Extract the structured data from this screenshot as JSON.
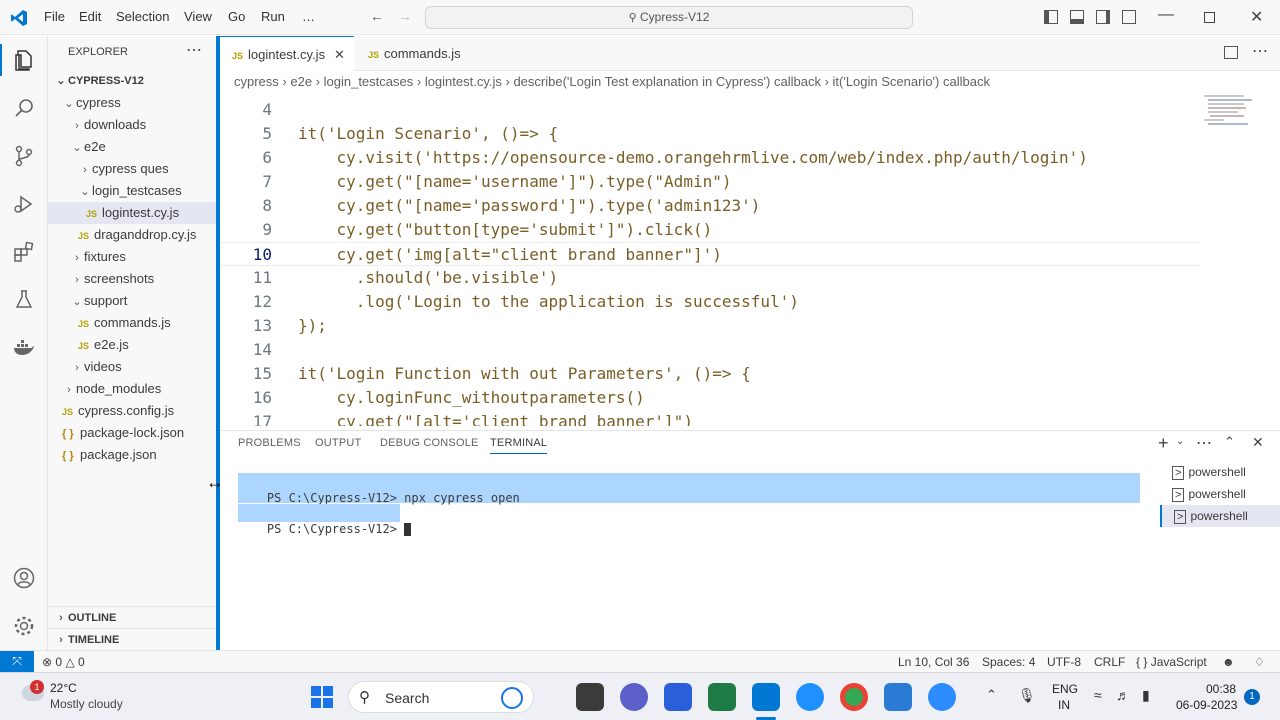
{
  "titlebar": {
    "menu": [
      "File",
      "Edit",
      "Selection",
      "View",
      "Go",
      "Run",
      "…"
    ],
    "command_center": "Cypress-V12"
  },
  "sidebar": {
    "header": "EXPLORER",
    "project": "CYPRESS-V12",
    "tree": [
      {
        "label": "cypress",
        "kind": "folder-open",
        "indent": 1
      },
      {
        "label": "downloads",
        "kind": "folder",
        "indent": 2
      },
      {
        "label": "e2e",
        "kind": "folder-open",
        "indent": 2
      },
      {
        "label": "cypress ques",
        "kind": "folder",
        "indent": 3
      },
      {
        "label": "login_testcases",
        "kind": "folder-open",
        "indent": 3
      },
      {
        "label": "logintest.cy.js",
        "kind": "js",
        "indent": 4,
        "selected": true
      },
      {
        "label": "draganddrop.cy.js",
        "kind": "js",
        "indent": 3
      },
      {
        "label": "fixtures",
        "kind": "folder",
        "indent": 2
      },
      {
        "label": "screenshots",
        "kind": "folder",
        "indent": 2
      },
      {
        "label": "support",
        "kind": "folder-open",
        "indent": 2
      },
      {
        "label": "commands.js",
        "kind": "js",
        "indent": 3
      },
      {
        "label": "e2e.js",
        "kind": "js",
        "indent": 3
      },
      {
        "label": "videos",
        "kind": "folder",
        "indent": 2
      },
      {
        "label": "node_modules",
        "kind": "folder",
        "indent": 1
      },
      {
        "label": "cypress.config.js",
        "kind": "js",
        "indent": 1
      },
      {
        "label": "package-lock.json",
        "kind": "json",
        "indent": 1
      },
      {
        "label": "package.json",
        "kind": "json",
        "indent": 1
      }
    ],
    "outline": "OUTLINE",
    "timeline": "TIMELINE"
  },
  "editor": {
    "tabs": [
      {
        "label": "logintest.cy.js",
        "active": true
      },
      {
        "label": "commands.js",
        "active": false
      }
    ],
    "breadcrumb": [
      "cypress",
      "e2e",
      "login_testcases",
      "logintest.cy.js",
      "describe('Login Test explanation in Cypress') callback",
      "it('Login Scenario') callback"
    ],
    "lines": [
      {
        "n": "4",
        "code": ""
      },
      {
        "n": "5",
        "code": "it('Login Scenario', ()=> {"
      },
      {
        "n": "6",
        "code": "    cy.visit('https://opensource-demo.orangehrmlive.com/web/index.php/auth/login')"
      },
      {
        "n": "7",
        "code": "    cy.get(\"[name='username']\").type(\"Admin\")"
      },
      {
        "n": "8",
        "code": "    cy.get(\"[name='password']\").type('admin123')"
      },
      {
        "n": "9",
        "code": "    cy.get(\"button[type='submit']\").click()"
      },
      {
        "n": "10",
        "code": "    cy.get('img[alt=\"client brand banner\"]')"
      },
      {
        "n": "11",
        "code": "      .should('be.visible')"
      },
      {
        "n": "12",
        "code": "      .log('Login to the application is successful')"
      },
      {
        "n": "13",
        "code": "});"
      },
      {
        "n": "14",
        "code": ""
      },
      {
        "n": "15",
        "code": "it('Login Function with out Parameters', ()=> {"
      },
      {
        "n": "16",
        "code": "    cy.loginFunc_withoutparameters()"
      },
      {
        "n": "17",
        "code": "    cy.get(\"[alt='client brand banner']\")"
      }
    ],
    "current_line": "10"
  },
  "panel": {
    "tabs": [
      "PROBLEMS",
      "OUTPUT",
      "DEBUG CONSOLE",
      "TERMINAL"
    ],
    "active_tab": "TERMINAL",
    "terminal_lines": [
      "PS C:\\Cypress-V12> npx cypress open",
      "PS C:\\Cypress-V12> "
    ],
    "terminals": [
      "powershell",
      "powershell",
      "powershell"
    ]
  },
  "statusbar": {
    "errors": "0",
    "warnings": "0",
    "position": "Ln 10, Col 36",
    "spaces": "Spaces: 4",
    "encoding": "UTF-8",
    "eol": "CRLF",
    "language": "JavaScript"
  },
  "taskbar": {
    "weather_temp": "22°C",
    "weather_desc": "Mostly cloudy",
    "weather_badge": "1",
    "search": "Search",
    "lang": "ENG",
    "region": "IN",
    "time": "00:38",
    "date": "06-09-2023",
    "notif_count": "1"
  },
  "colors": {
    "accent": "#0078d4",
    "selection": "#add6ff",
    "code_string": "#a31515",
    "code_keyword": "#795e26"
  }
}
